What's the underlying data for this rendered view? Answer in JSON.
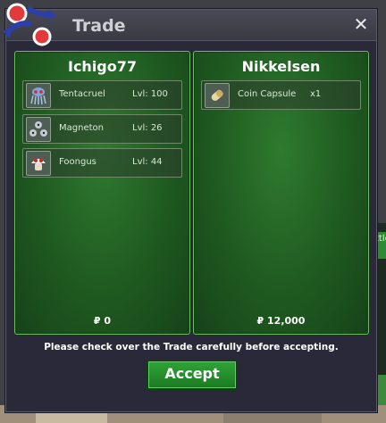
{
  "window": {
    "title": "Trade",
    "close_label": "✕"
  },
  "left_panel": {
    "trainer": "Ichigo77",
    "items": [
      {
        "name": "Tentacruel",
        "level": "Lvl: 100",
        "icon": "tentacruel-icon"
      },
      {
        "name": "Magneton",
        "level": "Lvl: 26",
        "icon": "magneton-icon"
      },
      {
        "name": "Foongus",
        "level": "Lvl: 44",
        "icon": "foongus-icon"
      }
    ],
    "money": "₽ 0"
  },
  "right_panel": {
    "trainer": "Nikkelsen",
    "items": [
      {
        "name": "Coin Capsule",
        "quantity": "x1",
        "icon": "coin-capsule-icon"
      }
    ],
    "money": "₽ 12,000"
  },
  "notice": "Please check over the Trade carefully before accepting.",
  "accept_label": "Accept",
  "background_fragment_text": "ttle",
  "colors": {
    "panel_green": "#1f5a20",
    "panel_border": "#6bbf5e",
    "button_green": "#2fa437",
    "window_bg": "#29293a"
  }
}
